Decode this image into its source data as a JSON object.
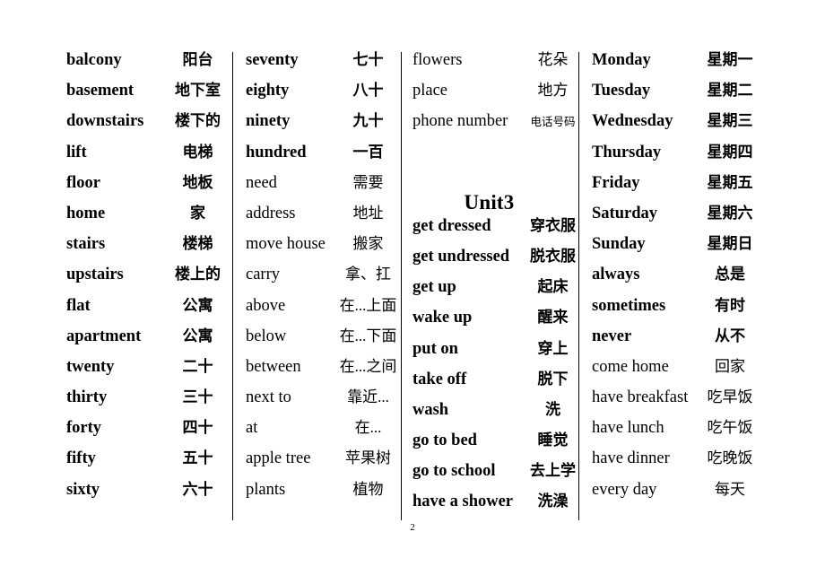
{
  "page": {
    "number": "2"
  },
  "columns": [
    {
      "id": "column-1",
      "rows": [
        {
          "term": "balcony",
          "gloss": "阳台",
          "bold": true
        },
        {
          "term": "basement",
          "gloss": "地下室",
          "bold": true
        },
        {
          "term": "downstairs",
          "gloss": "楼下的",
          "bold": true
        },
        {
          "term": "lift",
          "gloss": "电梯",
          "bold": true
        },
        {
          "term": "floor",
          "gloss": "地板",
          "bold": true
        },
        {
          "term": "home",
          "gloss": "家",
          "bold": true
        },
        {
          "term": "stairs",
          "gloss": "楼梯",
          "bold": true
        },
        {
          "term": "upstairs",
          "gloss": "楼上的",
          "bold": true
        },
        {
          "term": "flat",
          "gloss": "公寓",
          "bold": true
        },
        {
          "term": "apartment",
          "gloss": "公寓",
          "bold": true
        },
        {
          "term": "twenty",
          "gloss": "二十",
          "bold": true
        },
        {
          "term": "thirty",
          "gloss": "三十",
          "bold": true
        },
        {
          "term": "forty",
          "gloss": "四十",
          "bold": true
        },
        {
          "term": "fifty",
          "gloss": "五十",
          "bold": true
        },
        {
          "term": "sixty",
          "gloss": "六十",
          "bold": true
        }
      ]
    },
    {
      "id": "column-2",
      "rows": [
        {
          "term": "seventy",
          "gloss": "七十",
          "bold": true
        },
        {
          "term": "eighty",
          "gloss": "八十",
          "bold": true
        },
        {
          "term": "ninety",
          "gloss": "九十",
          "bold": true
        },
        {
          "term": "hundred",
          "gloss": "一百",
          "bold": true
        },
        {
          "term": "need",
          "gloss": "需要",
          "bold": false
        },
        {
          "term": "address",
          "gloss": "地址",
          "bold": false
        },
        {
          "term": "move house",
          "gloss": "搬家",
          "bold": false
        },
        {
          "term": "carry",
          "gloss": "拿、扛",
          "bold": false
        },
        {
          "term": "above",
          "gloss": "在...上面",
          "bold": false
        },
        {
          "term": "below",
          "gloss": "在...下面",
          "bold": false
        },
        {
          "term": "between",
          "gloss": "在...之间",
          "bold": false
        },
        {
          "term": "next to",
          "gloss": "靠近...",
          "bold": false
        },
        {
          "term": "at",
          "gloss": "在...",
          "bold": false
        },
        {
          "term": "apple tree",
          "gloss": "苹果树",
          "bold": false
        },
        {
          "term": "plants",
          "gloss": "植物",
          "bold": false
        }
      ]
    },
    {
      "id": "column-3",
      "heading": "Unit3",
      "rows_before_heading": [
        {
          "term": "flowers",
          "gloss": "花朵",
          "bold": false
        },
        {
          "term": "place",
          "gloss": "地方",
          "bold": false
        },
        {
          "term": "phone number",
          "gloss": "电话号码",
          "bold": false,
          "small_gloss": true
        }
      ],
      "rows_after_heading": [
        {
          "term": "get dressed",
          "gloss": "穿衣服",
          "bold": true
        },
        {
          "term": "get undressed",
          "gloss": "脱衣服",
          "bold": true
        },
        {
          "term": "get up",
          "gloss": "起床",
          "bold": true
        },
        {
          "term": "wake up",
          "gloss": "醒来",
          "bold": true
        },
        {
          "term": "put on",
          "gloss": "穿上",
          "bold": true
        },
        {
          "term": "take off",
          "gloss": "脱下",
          "bold": true
        },
        {
          "term": "wash",
          "gloss": "洗",
          "bold": true
        },
        {
          "term": "go to bed",
          "gloss": "睡觉",
          "bold": true
        },
        {
          "term": "go to school",
          "gloss": "去上学",
          "bold": true
        },
        {
          "term": "have a shower",
          "gloss": "洗澡",
          "bold": true
        }
      ]
    },
    {
      "id": "column-4",
      "rows": [
        {
          "term": "Monday",
          "gloss": "星期一",
          "bold": true
        },
        {
          "term": "Tuesday",
          "gloss": "星期二",
          "bold": true
        },
        {
          "term": "Wednesday",
          "gloss": "星期三",
          "bold": true
        },
        {
          "term": "Thursday",
          "gloss": "星期四",
          "bold": true
        },
        {
          "term": "Friday",
          "gloss": "星期五",
          "bold": true
        },
        {
          "term": "Saturday",
          "gloss": "星期六",
          "bold": true
        },
        {
          "term": "Sunday",
          "gloss": "星期日",
          "bold": true
        },
        {
          "term": "always",
          "gloss": "总是",
          "bold": true
        },
        {
          "term": "sometimes",
          "gloss": "有时",
          "bold": true
        },
        {
          "term": "never",
          "gloss": "从不",
          "bold": true
        },
        {
          "term": "come home",
          "gloss": "回家",
          "bold": false
        },
        {
          "term": "have breakfast",
          "gloss": "吃早饭",
          "bold": false
        },
        {
          "term": "have lunch",
          "gloss": "吃午饭",
          "bold": false
        },
        {
          "term": "have dinner",
          "gloss": "吃晚饭",
          "bold": false
        },
        {
          "term": "every day",
          "gloss": "每天",
          "bold": false
        }
      ]
    }
  ]
}
